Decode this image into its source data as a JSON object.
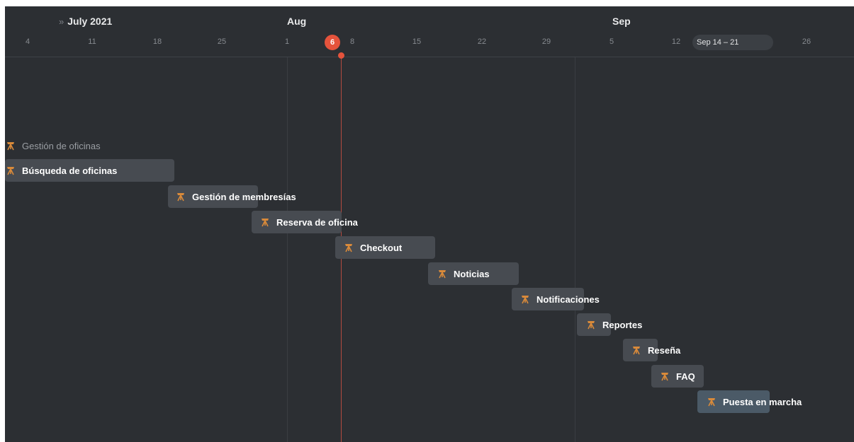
{
  "timeline": {
    "months": [
      {
        "label": "July 2021",
        "has_chevron": true,
        "chevron": "»"
      },
      {
        "label": "Aug"
      },
      {
        "label": "Sep"
      }
    ],
    "days": [
      "4",
      "11",
      "18",
      "25",
      "1",
      "8",
      "15",
      "22",
      "29",
      "5",
      "12",
      "26"
    ],
    "today": "6",
    "week_range": "Sep 14 – 21"
  },
  "tasks": [
    {
      "label": "Gestión de oficinas",
      "icon": "telescope-icon"
    },
    {
      "label": "Búsqueda de oficinas",
      "icon": "telescope-icon"
    },
    {
      "label": "Gestión de membresías",
      "icon": "telescope-icon"
    },
    {
      "label": "Reserva de oficina",
      "icon": "telescope-icon"
    },
    {
      "label": "Checkout",
      "icon": "telescope-icon"
    },
    {
      "label": "Noticias",
      "icon": "telescope-icon"
    },
    {
      "label": "Notificaciones",
      "icon": "telescope-icon"
    },
    {
      "label": "Reportes",
      "icon": "telescope-icon"
    },
    {
      "label": "Reseña",
      "icon": "telescope-icon"
    },
    {
      "label": "FAQ",
      "icon": "telescope-icon"
    },
    {
      "label": "Puesta en marcha",
      "icon": "telescope-icon"
    }
  ],
  "colors": {
    "background": "#2c2f33",
    "bar": "#474b51",
    "bar_highlight": "#4b5a67",
    "today": "#e5533c",
    "icon": "#d98a3a"
  }
}
